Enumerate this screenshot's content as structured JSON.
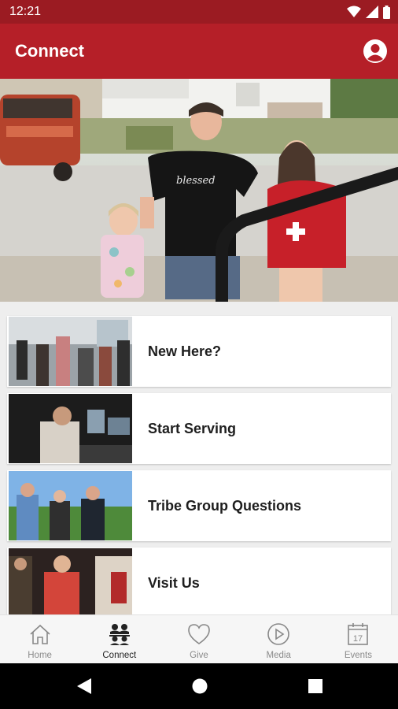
{
  "status_bar": {
    "time": "12:21"
  },
  "app_bar": {
    "title": "Connect"
  },
  "cards": [
    {
      "label": "New Here?"
    },
    {
      "label": "Start Serving"
    },
    {
      "label": "Tribe Group Questions"
    },
    {
      "label": "Visit Us"
    }
  ],
  "hero": {
    "shirt_text": "blessed"
  },
  "bottom_nav": [
    {
      "label": "Home",
      "icon": "home-icon",
      "active": false
    },
    {
      "label": "Connect",
      "icon": "people-icon",
      "active": true
    },
    {
      "label": "Give",
      "icon": "heart-icon",
      "active": false
    },
    {
      "label": "Media",
      "icon": "play-icon",
      "active": false
    },
    {
      "label": "Events",
      "icon": "calendar-icon",
      "active": false
    }
  ],
  "calendar_day": "17",
  "colors": {
    "app_bar": "#b51f28",
    "status_bar": "#9b1b22",
    "accent": "#b51f28"
  }
}
